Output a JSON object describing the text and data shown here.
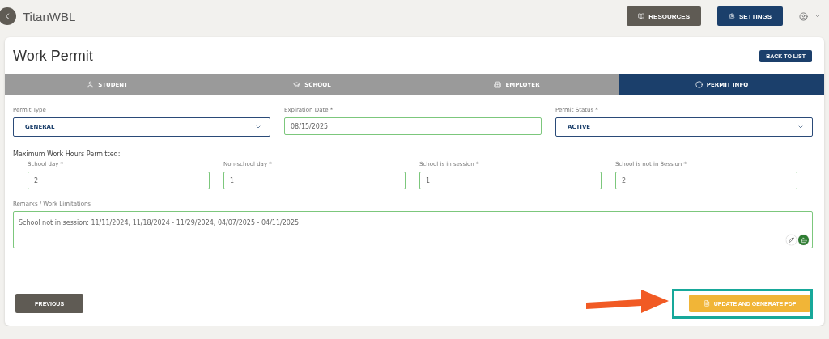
{
  "app": {
    "title": "TitanWBL"
  },
  "header_buttons": [
    {
      "kind": "resources",
      "label": "RESOURCES"
    },
    {
      "kind": "settings",
      "label": "SETTINGS"
    }
  ],
  "page": {
    "title": "Work Permit",
    "back_button": "BACK TO LIST"
  },
  "tabs": [
    {
      "kind": "student",
      "label": "STUDENT",
      "selected": false
    },
    {
      "kind": "school",
      "label": "SCHOOL",
      "selected": false
    },
    {
      "kind": "employer",
      "label": "EMPLOYER",
      "selected": false
    },
    {
      "kind": "info",
      "label": "PERMIT INFO",
      "selected": true
    }
  ],
  "top_fields": [
    {
      "kind": "select",
      "label": "Permit Type",
      "value": "GENERAL"
    },
    {
      "kind": "text",
      "label": "Expiration Date *",
      "value": "08/15/2025"
    },
    {
      "kind": "select",
      "label": "Permit Status *",
      "value": "ACTIVE"
    }
  ],
  "hours": {
    "heading": "Maximum Work Hours Permitted:",
    "fields": [
      {
        "label": "School day *",
        "value": "2"
      },
      {
        "label": "Non-school day *",
        "value": "1"
      },
      {
        "label": "School is in session *",
        "value": "1"
      },
      {
        "label": "School is not in Session *",
        "value": "2"
      }
    ]
  },
  "remarks": {
    "label": "Remarks / Work Limitations",
    "value": "School not in session: 11/11/2024, 11/18/2024 - 11/29/2024, 04/07/2025 - 04/11/2025"
  },
  "footer": {
    "previous": "PREVIOUS",
    "submit": "UPDATE AND GENERATE PDF",
    "highlighted": true
  }
}
